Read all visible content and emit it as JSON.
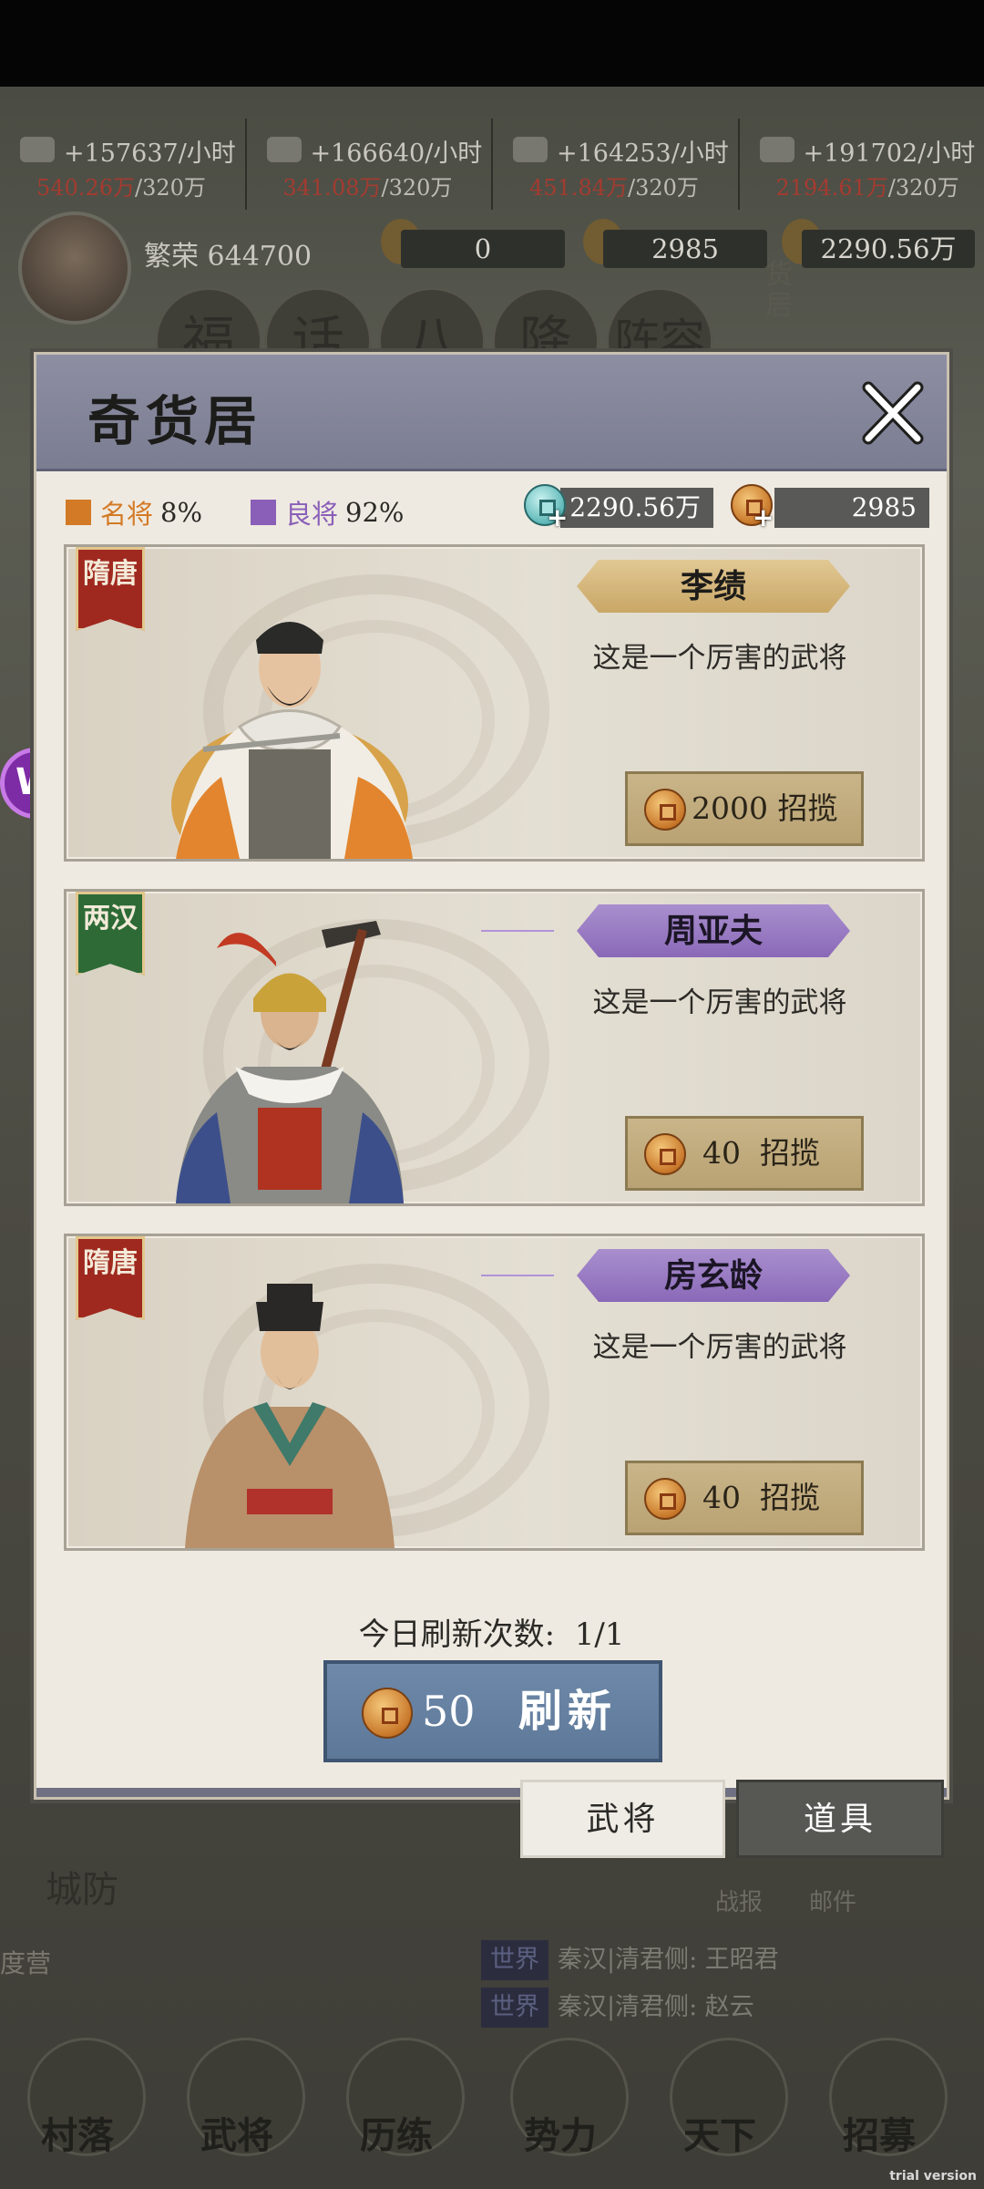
{
  "resources": [
    {
      "rate": "+157637/小时",
      "current": "540.26万",
      "cap": "/320万"
    },
    {
      "rate": "+166640/小时",
      "current": "341.08万",
      "cap": "/320万"
    },
    {
      "rate": "+164253/小时",
      "current": "451.84万",
      "cap": "/320万"
    },
    {
      "rate": "+191702/小时",
      "current": "2194.61万",
      "cap": "/320万"
    }
  ],
  "player": {
    "prosperity_label": "繁荣",
    "prosperity_value": "644700",
    "stat_a": "0",
    "stat_b": "2985",
    "stat_c": "2290.56万"
  },
  "bg_buttons": [
    "福",
    "话",
    "八",
    "降",
    "阵容"
  ],
  "bg_nav": [
    "村落",
    "武将",
    "历练",
    "势力",
    "天下",
    "招募"
  ],
  "bg_misc": {
    "chengfang": "城防",
    "duying": "度营",
    "zhanbao": "战报",
    "youjian": "邮件",
    "huoju": "货居"
  },
  "chat": [
    {
      "tag": "世界",
      "text": "秦汉|清君侧: 王昭君"
    },
    {
      "tag": "世界",
      "text": "秦汉|清君侧: 赵云"
    }
  ],
  "modal": {
    "title": "奇货居",
    "legend_famous": "名将",
    "legend_famous_pct": "8%",
    "legend_good": "良将",
    "legend_good_pct": "92%",
    "currency_jade": "2290.56万",
    "currency_gold": "2985",
    "generals": [
      {
        "era": "隋唐",
        "name": "李绩",
        "desc": "这是一个厉害的武将",
        "cost": "2000",
        "action": "招揽",
        "tier": "gold"
      },
      {
        "era": "两汉",
        "name": "周亚夫",
        "desc": "这是一个厉害的武将",
        "cost": "40",
        "action": "招揽",
        "tier": "purple"
      },
      {
        "era": "隋唐",
        "name": "房玄龄",
        "desc": "这是一个厉害的武将",
        "cost": "40",
        "action": "招揽",
        "tier": "purple"
      }
    ],
    "refresh_label": "今日刷新次数:",
    "refresh_count": "1/1",
    "refresh_cost": "50",
    "refresh_action": "刷新",
    "tabs": [
      "武将",
      "道具"
    ]
  },
  "colors": {
    "famous": "#d37a26",
    "good": "#8a5fb8",
    "header": "#7f8196",
    "refresh_button": "#6480a0"
  },
  "watermark": "trial version"
}
